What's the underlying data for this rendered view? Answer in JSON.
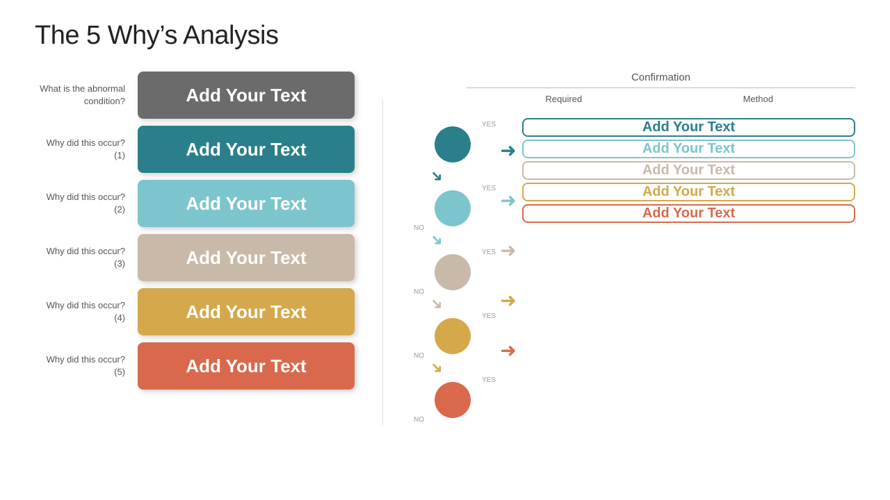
{
  "title": "The 5 Why’s Analysis",
  "left": {
    "rows": [
      {
        "label": "What is the abnormal condition?",
        "text": "Add Your Text",
        "boxClass": "box-gray"
      },
      {
        "label": "Why did this occur? (1)",
        "text": "Add Your Text",
        "boxClass": "box-teal"
      },
      {
        "label": "Why did this occur? (2)",
        "text": "Add Your Text",
        "boxClass": "box-ltblue"
      },
      {
        "label": "Why did this occur? (3)",
        "text": "Add Your Text",
        "boxClass": "box-beige"
      },
      {
        "label": "Why did this occur? (4)",
        "text": "Add Your Text",
        "boxClass": "box-gold"
      },
      {
        "label": "Why did this occur? (5)",
        "text": "Add Your Text",
        "boxClass": "box-orange"
      }
    ]
  },
  "right": {
    "header": "Confirmation",
    "sub_required": "Required",
    "sub_method": "Method",
    "nodes": [
      {
        "circleClass": "circle-teal",
        "arrowClass": "arrow-teal",
        "confClass": "conf-teal",
        "text": "Add Your Text"
      },
      {
        "circleClass": "circle-ltblue",
        "arrowClass": "arrow-ltblue",
        "confClass": "conf-ltblue",
        "text": "Add Your Text"
      },
      {
        "circleClass": "circle-beige",
        "arrowClass": "arrow-beige",
        "confClass": "conf-beige",
        "text": "Add Your Text"
      },
      {
        "circleClass": "circle-gold",
        "arrowClass": "arrow-gold",
        "confClass": "conf-gold",
        "text": "Add Your Text"
      },
      {
        "circleClass": "circle-orange",
        "arrowClass": "arrow-orange",
        "confClass": "conf-orange",
        "text": "Add Your Text"
      }
    ]
  }
}
